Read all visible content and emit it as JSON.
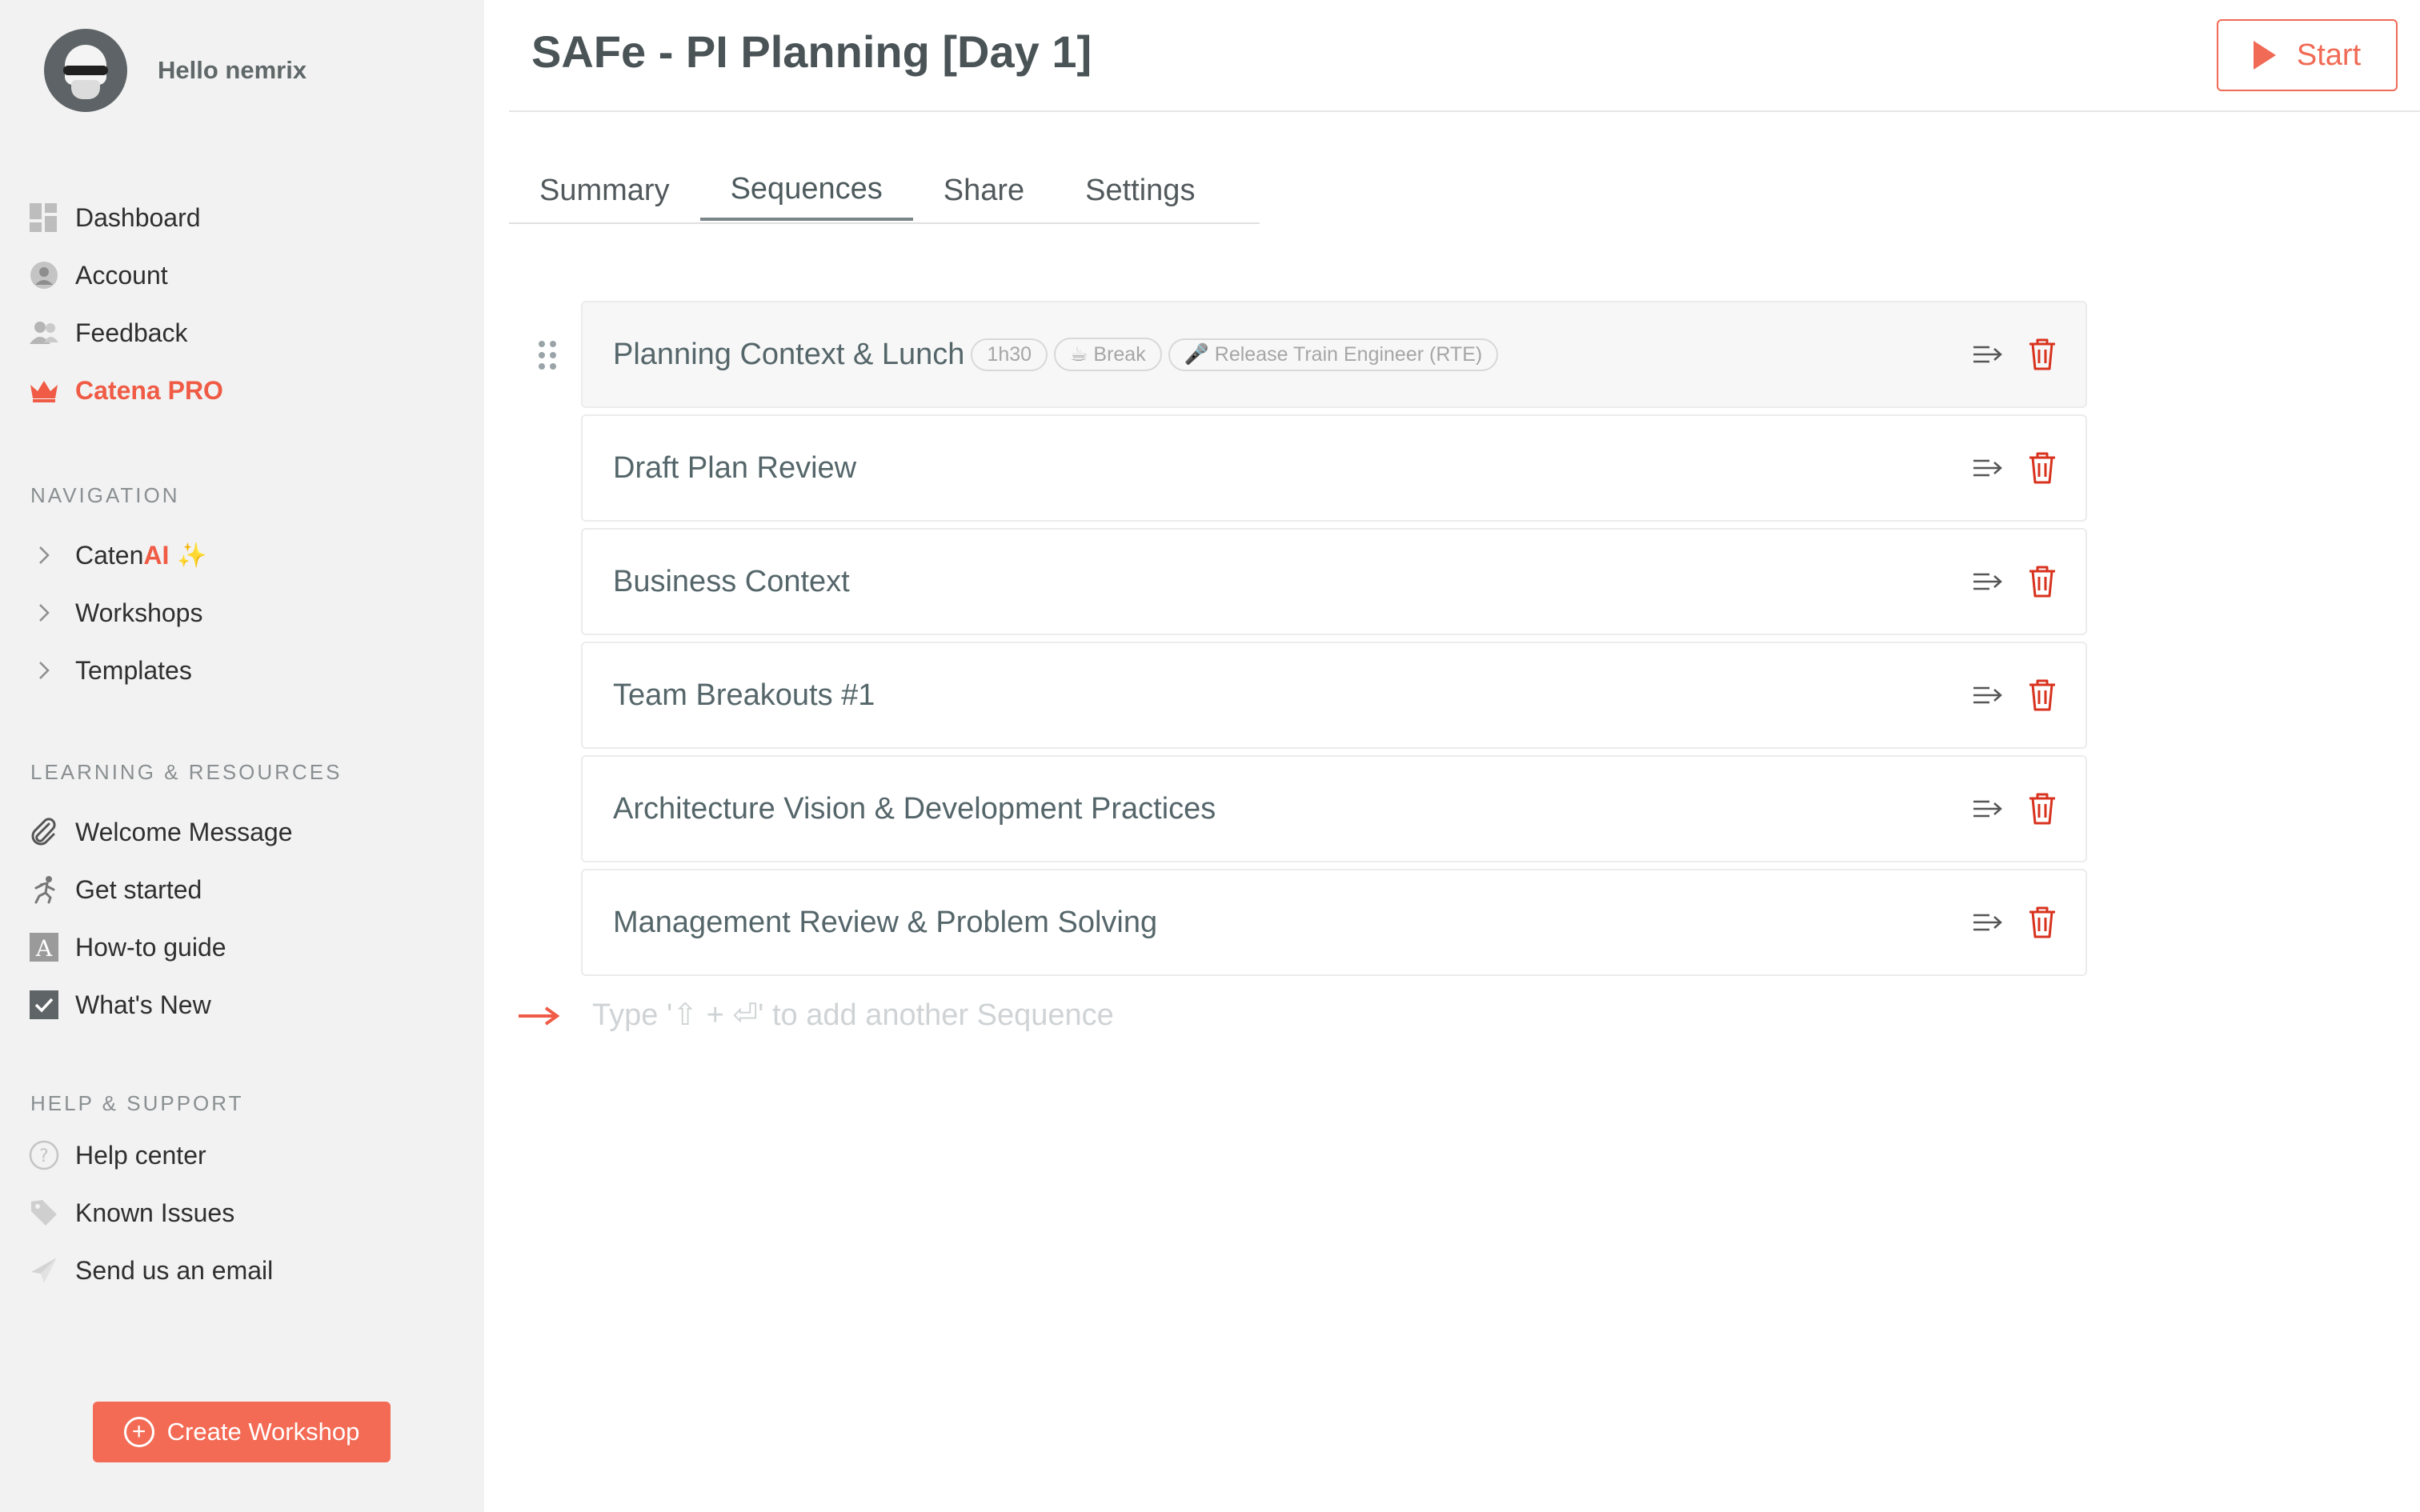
{
  "user": {
    "greeting": "Hello nemrix"
  },
  "sidebar": {
    "main_items": [
      {
        "label": "Dashboard",
        "icon": "dashboard-icon"
      },
      {
        "label": "Account",
        "icon": "account-icon"
      },
      {
        "label": "Feedback",
        "icon": "feedback-icon"
      },
      {
        "label": "Catena PRO",
        "icon": "crown-icon"
      }
    ],
    "navigation": {
      "title": "NAVIGATION",
      "caten_prefix": "Caten",
      "caten_suffix": "AI",
      "sparkle": "✨",
      "items": [
        "Workshops",
        "Templates"
      ]
    },
    "learning": {
      "title": "LEARNING & RESOURCES",
      "items": [
        {
          "label": "Welcome Message",
          "icon": "paperclip-icon"
        },
        {
          "label": "Get started",
          "icon": "runner-icon"
        },
        {
          "label": "How-to guide",
          "icon": "guide-icon"
        },
        {
          "label": "What's New",
          "icon": "checkbox-icon"
        }
      ]
    },
    "help": {
      "title": "HELP & SUPPORT",
      "items": [
        {
          "label": "Help center",
          "icon": "question-icon"
        },
        {
          "label": "Known Issues",
          "icon": "tag-icon"
        },
        {
          "label": "Send us an email",
          "icon": "send-icon"
        }
      ]
    },
    "create_button": "Create Workshop"
  },
  "header": {
    "title": "SAFe - PI Planning [Day 1]",
    "start_label": "Start"
  },
  "tabs": [
    {
      "label": "Summary",
      "active": false
    },
    {
      "label": "Sequences",
      "active": true
    },
    {
      "label": "Share",
      "active": false
    },
    {
      "label": "Settings",
      "active": false
    }
  ],
  "sequences": [
    {
      "title": "Planning Context & Lunch",
      "tags": [
        "1h30",
        "☕ Break",
        "🎤 Release Train Engineer (RTE)"
      ]
    },
    {
      "title": "Draft Plan Review"
    },
    {
      "title": "Business Context"
    },
    {
      "title": "Team Breakouts #1"
    },
    {
      "title": "Architecture Vision & Development Practices"
    },
    {
      "title": "Management Review & Problem Solving"
    }
  ],
  "add_sequence": {
    "placeholder": "Type '⇧ + ⏎' to add another Sequence"
  },
  "colors": {
    "accent": "#f05b45",
    "sidebar_bg": "#f2f2f2",
    "text": "#55666a"
  }
}
